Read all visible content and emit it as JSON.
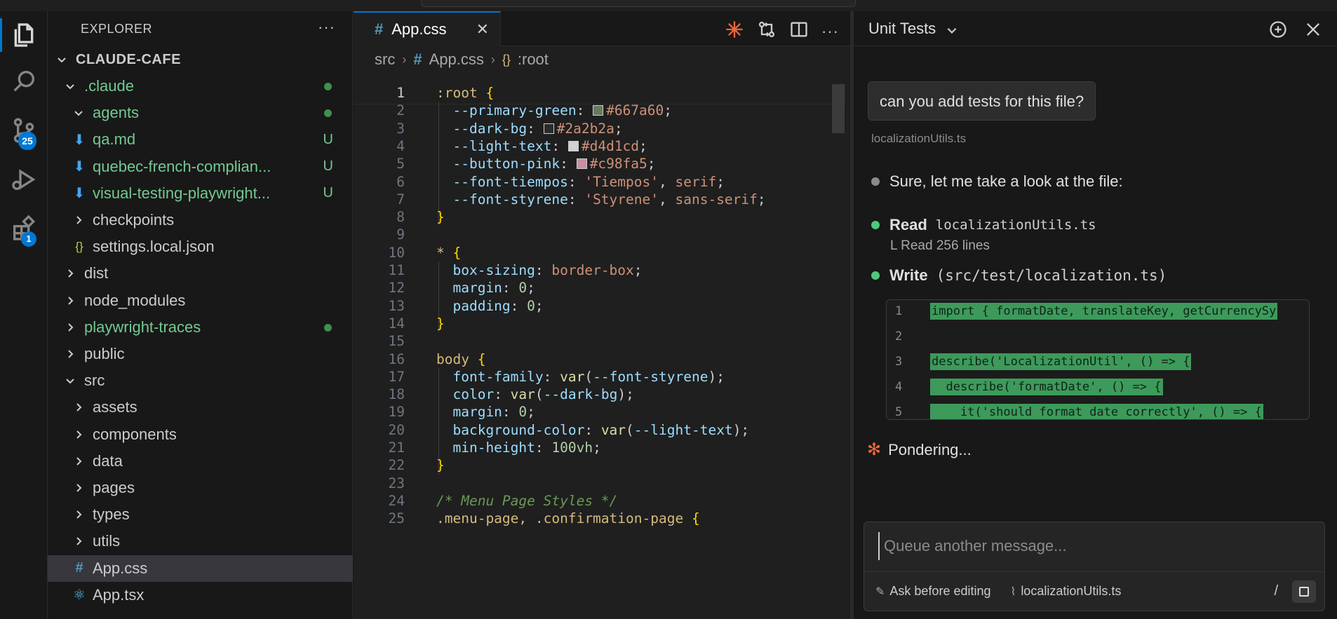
{
  "activity": {
    "scm_badge": "25",
    "extensions_badge": "1"
  },
  "explorer": {
    "title": "EXPLORER",
    "root": "CLAUDE-CAFE",
    "items": [
      {
        "label": ".claude",
        "depth": 1,
        "type": "folder-open",
        "color": "green",
        "dot": true
      },
      {
        "label": "agents",
        "depth": 2,
        "type": "folder-open",
        "color": "green",
        "dot": true
      },
      {
        "label": "qa.md",
        "depth": 2,
        "type": "md",
        "color": "green",
        "status": "U"
      },
      {
        "label": "quebec-french-complian...",
        "depth": 2,
        "type": "md",
        "color": "green",
        "status": "U"
      },
      {
        "label": "visual-testing-playwright...",
        "depth": 2,
        "type": "md",
        "color": "green",
        "status": "U"
      },
      {
        "label": "checkpoints",
        "depth": 2,
        "type": "folder",
        "color": ""
      },
      {
        "label": "settings.local.json",
        "depth": 2,
        "type": "json",
        "color": ""
      },
      {
        "label": "dist",
        "depth": 1,
        "type": "folder",
        "color": ""
      },
      {
        "label": "node_modules",
        "depth": 1,
        "type": "folder",
        "color": ""
      },
      {
        "label": "playwright-traces",
        "depth": 1,
        "type": "folder",
        "color": "green",
        "dot": true
      },
      {
        "label": "public",
        "depth": 1,
        "type": "folder",
        "color": ""
      },
      {
        "label": "src",
        "depth": 1,
        "type": "folder-open",
        "color": ""
      },
      {
        "label": "assets",
        "depth": 2,
        "type": "folder",
        "color": ""
      },
      {
        "label": "components",
        "depth": 2,
        "type": "folder",
        "color": ""
      },
      {
        "label": "data",
        "depth": 2,
        "type": "folder",
        "color": ""
      },
      {
        "label": "pages",
        "depth": 2,
        "type": "folder",
        "color": ""
      },
      {
        "label": "types",
        "depth": 2,
        "type": "folder",
        "color": ""
      },
      {
        "label": "utils",
        "depth": 2,
        "type": "folder",
        "color": ""
      },
      {
        "label": "App.css",
        "depth": 2,
        "type": "css",
        "color": "",
        "selected": true
      },
      {
        "label": "App.tsx",
        "depth": 2,
        "type": "tsx",
        "color": ""
      }
    ]
  },
  "editor": {
    "tab_label": "App.css",
    "tab_close": "✕",
    "breadcrumb": {
      "folder": "src",
      "file": "App.css",
      "symbol": ":root"
    },
    "lines": [
      {
        "n": "1",
        "parts": [
          [
            "t-sel",
            ":root "
          ],
          [
            "t-brace",
            "{"
          ]
        ]
      },
      {
        "n": "2",
        "parts": [
          [
            "t-prop",
            "  --primary-green"
          ],
          [
            "t-punc",
            ": "
          ],
          [
            "sw",
            "#667a60"
          ],
          [
            "t-val",
            "#667a60"
          ],
          [
            "t-punc",
            ";"
          ]
        ]
      },
      {
        "n": "3",
        "parts": [
          [
            "t-prop",
            "  --dark-bg"
          ],
          [
            "t-punc",
            ": "
          ],
          [
            "sw",
            "#2a2b2a"
          ],
          [
            "t-val",
            "#2a2b2a"
          ],
          [
            "t-punc",
            ";"
          ]
        ]
      },
      {
        "n": "4",
        "parts": [
          [
            "t-prop",
            "  --light-text"
          ],
          [
            "t-punc",
            ": "
          ],
          [
            "sw",
            "#d4d1cd"
          ],
          [
            "t-val",
            "#d4d1cd"
          ],
          [
            "t-punc",
            ";"
          ]
        ]
      },
      {
        "n": "5",
        "parts": [
          [
            "t-prop",
            "  --button-pink"
          ],
          [
            "t-punc",
            ": "
          ],
          [
            "sw",
            "#c98fa5"
          ],
          [
            "t-val",
            "#c98fa5"
          ],
          [
            "t-punc",
            ";"
          ]
        ]
      },
      {
        "n": "6",
        "parts": [
          [
            "t-prop",
            "  --font-tiempos"
          ],
          [
            "t-punc",
            ": "
          ],
          [
            "t-val",
            "'Tiempos'"
          ],
          [
            "t-punc",
            ", "
          ],
          [
            "t-val",
            "serif"
          ],
          [
            "t-punc",
            ";"
          ]
        ]
      },
      {
        "n": "7",
        "parts": [
          [
            "t-prop",
            "  --font-styrene"
          ],
          [
            "t-punc",
            ": "
          ],
          [
            "t-val",
            "'Styrene'"
          ],
          [
            "t-punc",
            ", "
          ],
          [
            "t-val",
            "sans-serif"
          ],
          [
            "t-punc",
            ";"
          ]
        ]
      },
      {
        "n": "8",
        "parts": [
          [
            "t-brace",
            "}"
          ]
        ]
      },
      {
        "n": "9",
        "parts": []
      },
      {
        "n": "10",
        "parts": [
          [
            "t-sel",
            "* "
          ],
          [
            "t-brace",
            "{"
          ]
        ]
      },
      {
        "n": "11",
        "parts": [
          [
            "t-prop",
            "  box-sizing"
          ],
          [
            "t-punc",
            ": "
          ],
          [
            "t-val",
            "border-box"
          ],
          [
            "t-punc",
            ";"
          ]
        ]
      },
      {
        "n": "12",
        "parts": [
          [
            "t-prop",
            "  margin"
          ],
          [
            "t-punc",
            ": "
          ],
          [
            "t-num",
            "0"
          ],
          [
            "t-punc",
            ";"
          ]
        ]
      },
      {
        "n": "13",
        "parts": [
          [
            "t-prop",
            "  padding"
          ],
          [
            "t-punc",
            ": "
          ],
          [
            "t-num",
            "0"
          ],
          [
            "t-punc",
            ";"
          ]
        ]
      },
      {
        "n": "14",
        "parts": [
          [
            "t-brace",
            "}"
          ]
        ]
      },
      {
        "n": "15",
        "parts": []
      },
      {
        "n": "16",
        "parts": [
          [
            "t-sel",
            "body "
          ],
          [
            "t-brace",
            "{"
          ]
        ]
      },
      {
        "n": "17",
        "parts": [
          [
            "t-prop",
            "  font-family"
          ],
          [
            "t-punc",
            ": "
          ],
          [
            "t-fn",
            "var"
          ],
          [
            "t-punc",
            "("
          ],
          [
            "t-prop",
            "--font-styrene"
          ],
          [
            "t-punc",
            ");"
          ]
        ]
      },
      {
        "n": "18",
        "parts": [
          [
            "t-prop",
            "  color"
          ],
          [
            "t-punc",
            ": "
          ],
          [
            "t-fn",
            "var"
          ],
          [
            "t-punc",
            "("
          ],
          [
            "t-prop",
            "--dark-bg"
          ],
          [
            "t-punc",
            ");"
          ]
        ]
      },
      {
        "n": "19",
        "parts": [
          [
            "t-prop",
            "  margin"
          ],
          [
            "t-punc",
            ": "
          ],
          [
            "t-num",
            "0"
          ],
          [
            "t-punc",
            ";"
          ]
        ]
      },
      {
        "n": "20",
        "parts": [
          [
            "t-prop",
            "  background-color"
          ],
          [
            "t-punc",
            ": "
          ],
          [
            "t-fn",
            "var"
          ],
          [
            "t-punc",
            "("
          ],
          [
            "t-prop",
            "--light-text"
          ],
          [
            "t-punc",
            ");"
          ]
        ]
      },
      {
        "n": "21",
        "parts": [
          [
            "t-prop",
            "  min-height"
          ],
          [
            "t-punc",
            ": "
          ],
          [
            "t-num",
            "100vh"
          ],
          [
            "t-punc",
            ";"
          ]
        ]
      },
      {
        "n": "22",
        "parts": [
          [
            "t-brace",
            "}"
          ]
        ]
      },
      {
        "n": "23",
        "parts": []
      },
      {
        "n": "24",
        "parts": [
          [
            "t-com",
            "/* Menu Page Styles */"
          ]
        ]
      },
      {
        "n": "25",
        "parts": [
          [
            "t-sel",
            ".menu-page, .confirmation-page "
          ],
          [
            "t-brace",
            "{"
          ]
        ]
      }
    ]
  },
  "chat": {
    "title": "Unit Tests",
    "user_message": "can you add tests for this file?",
    "context_file": "localizationUtils.ts",
    "step1": "Sure, let me take a look at the file:",
    "read_label": "Read",
    "read_target": "localizationUtils.ts",
    "read_result": "L  Read 256 lines",
    "write_label": "Write",
    "write_target": "(src/test/localization.ts)",
    "diff": [
      {
        "n": "1",
        "code": "import { formatDate, translateKey, getCurrencySy"
      },
      {
        "n": "2",
        "code": ""
      },
      {
        "n": "3",
        "code": "describe('LocalizationUtil', () => {"
      },
      {
        "n": "4",
        "code": "  describe('formatDate', () => {"
      },
      {
        "n": "5",
        "code": "    it('should format date correctly', () => {"
      }
    ],
    "status": "Pondering...",
    "composer": {
      "placeholder": "Queue another message...",
      "mode": "Ask before editing",
      "attached_file": "localizationUtils.ts",
      "slash": "/"
    }
  }
}
